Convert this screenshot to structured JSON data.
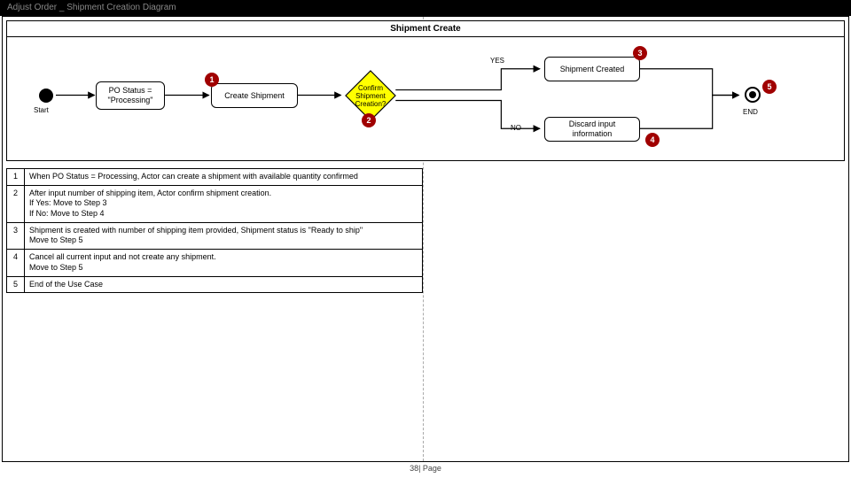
{
  "title": "Adjust Order _ Shipment Creation Diagram",
  "lane_title": "Shipment Create",
  "nodes": {
    "start_label": "Start",
    "po_status": "PO Status = \"Processing\"",
    "create_shipment": "Create Shipment",
    "confirm_q": "Confirm Shipment Creation?",
    "yes": "YES",
    "no": "NO",
    "shipment_created": "Shipment Created",
    "discard": "Discard input information",
    "end_label": "END"
  },
  "badges": {
    "b1": "1",
    "b2": "2",
    "b3": "3",
    "b4": "4",
    "b5": "5"
  },
  "steps": [
    {
      "n": "1",
      "text": "When PO Status = Processing, Actor can create a shipment with available quantity confirmed"
    },
    {
      "n": "2",
      "text": "After input number of shipping item, Actor confirm shipment creation.\nIf Yes: Move to Step 3\nIf No: Move to Step 4"
    },
    {
      "n": "3",
      "text": "Shipment is created with number of shipping item provided, Shipment status is \"Ready to ship\"\nMove to Step 5"
    },
    {
      "n": "4",
      "text": "Cancel all current input and not create any shipment.\nMove to Step 5"
    },
    {
      "n": "5",
      "text": "End of the Use Case"
    }
  ],
  "footer": "38| Page"
}
